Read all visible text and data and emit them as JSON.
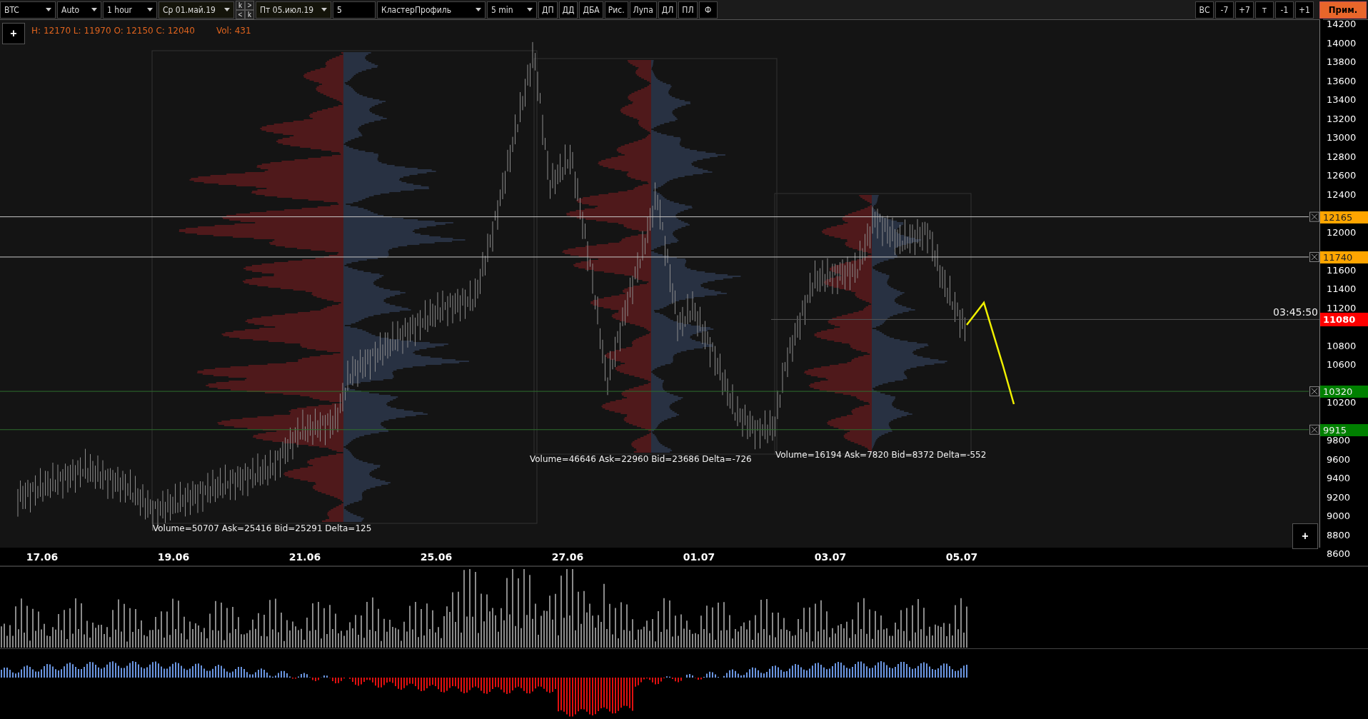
{
  "toolbar": {
    "left": [
      {
        "kind": "dropdown",
        "label": "BTC"
      },
      {
        "kind": "dropdown",
        "label": "Auto"
      },
      {
        "kind": "dropdown",
        "label": "1 hour"
      },
      {
        "kind": "date",
        "label": "Ср 01.май.19"
      },
      {
        "kind": "nav",
        "keys": [
          "k",
          ">",
          "<",
          "k"
        ]
      },
      {
        "kind": "date",
        "label": "Пт 05.июл.19"
      },
      {
        "kind": "field",
        "label": "5"
      },
      {
        "kind": "dropdown",
        "label": "КластерПрофиль"
      },
      {
        "kind": "dropdown",
        "label": "5 min"
      },
      {
        "kind": "button",
        "label": "ДП"
      },
      {
        "kind": "button",
        "label": "ДД"
      },
      {
        "kind": "button",
        "label": "ДБА"
      },
      {
        "kind": "button",
        "label": "Рис."
      },
      {
        "kind": "button",
        "label": "Лупа"
      },
      {
        "kind": "button",
        "label": "ДЛ"
      },
      {
        "kind": "button",
        "label": "ПЛ"
      },
      {
        "kind": "button",
        "label": "Ф"
      }
    ],
    "right": [
      {
        "kind": "button",
        "label": "ВС"
      },
      {
        "kind": "button",
        "label": "-7"
      },
      {
        "kind": "button",
        "label": "+7"
      },
      {
        "kind": "button",
        "label": "т"
      },
      {
        "kind": "button",
        "label": "-1"
      },
      {
        "kind": "button",
        "label": "+1"
      },
      {
        "kind": "accent",
        "label": "Прим."
      }
    ]
  },
  "chart": {
    "add_button": "+",
    "ohlc": "H: 12170 L: 11970 O: 12150 C: 12040",
    "volume": "Vol: 431",
    "price_axis": [
      "14200",
      "14000",
      "13800",
      "13600",
      "13400",
      "13200",
      "13000",
      "12800",
      "12600",
      "12400",
      "12000",
      "11600",
      "11400",
      "11200",
      "10800",
      "10600",
      "10200",
      "9800",
      "9600",
      "9400",
      "9200",
      "9000",
      "8800",
      "8600"
    ],
    "levels": [
      {
        "price": "12165",
        "color": "#ffa500"
      },
      {
        "price": "11740",
        "color": "#ffa500"
      },
      {
        "price": "10320",
        "color": "#008000"
      },
      {
        "price": "9915",
        "color": "#008000"
      }
    ],
    "current": {
      "price": "11080",
      "time": "03:45:50"
    },
    "profiles": [
      {
        "summary": "Volume=50707  Ask=25416  Bid=25291  Delta=125"
      },
      {
        "summary": "Volume=46646  Ask=22960  Bid=23686  Delta=-726"
      },
      {
        "summary": "Volume=16194  Ask=7820  Bid=8372  Delta=-552"
      }
    ],
    "corner_button": "+",
    "dates": [
      "17.06",
      "19.06",
      "21.06",
      "25.06",
      "27.06",
      "01.07",
      "03.07",
      "05.07"
    ]
  }
}
